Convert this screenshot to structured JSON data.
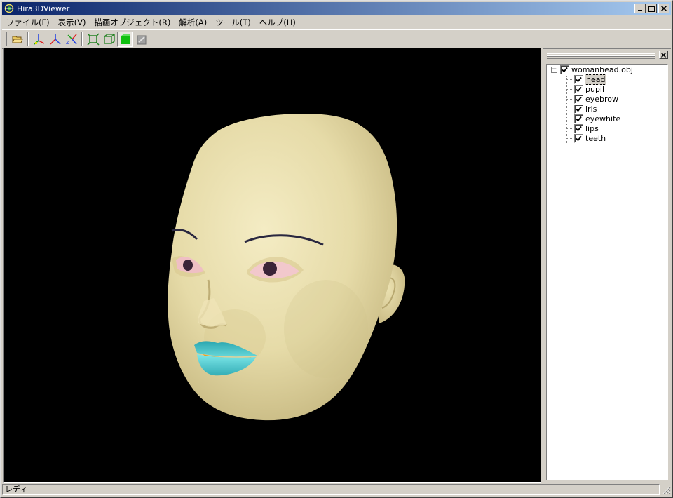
{
  "window": {
    "title": "Hira3DViewer"
  },
  "menu": [
    {
      "label": "ファイル(F)"
    },
    {
      "label": "表示(V)"
    },
    {
      "label": "描画オブジェクト(R)"
    },
    {
      "label": "解析(A)"
    },
    {
      "label": "ツール(T)"
    },
    {
      "label": "ヘルプ(H)"
    }
  ],
  "toolbar": {
    "icons": [
      "open-folder-icon",
      "axis-xyz-icon",
      "axis-y-icon",
      "axis-xz-icon",
      "fit-view-icon",
      "wireframe-icon",
      "solid-shading-icon",
      "texture-shading-icon"
    ]
  },
  "tree": {
    "root": {
      "label": "womanhead.obj",
      "checked": true,
      "expanded": true
    },
    "children": [
      {
        "label": "head",
        "checked": true,
        "selected": true
      },
      {
        "label": "pupil",
        "checked": true
      },
      {
        "label": "eyebrow",
        "checked": true
      },
      {
        "label": "iris",
        "checked": true
      },
      {
        "label": "eyewhite",
        "checked": true
      },
      {
        "label": "lips",
        "checked": true
      },
      {
        "label": "teeth",
        "checked": true
      }
    ]
  },
  "status": {
    "text": "レディ"
  },
  "colors": {
    "title_start": "#0a246a",
    "title_end": "#a6caf0",
    "face_skin": "#e9dfae",
    "lips": "#4fc6c8",
    "eyewhite": "#f2c8cc",
    "viewport_bg": "#000000"
  }
}
